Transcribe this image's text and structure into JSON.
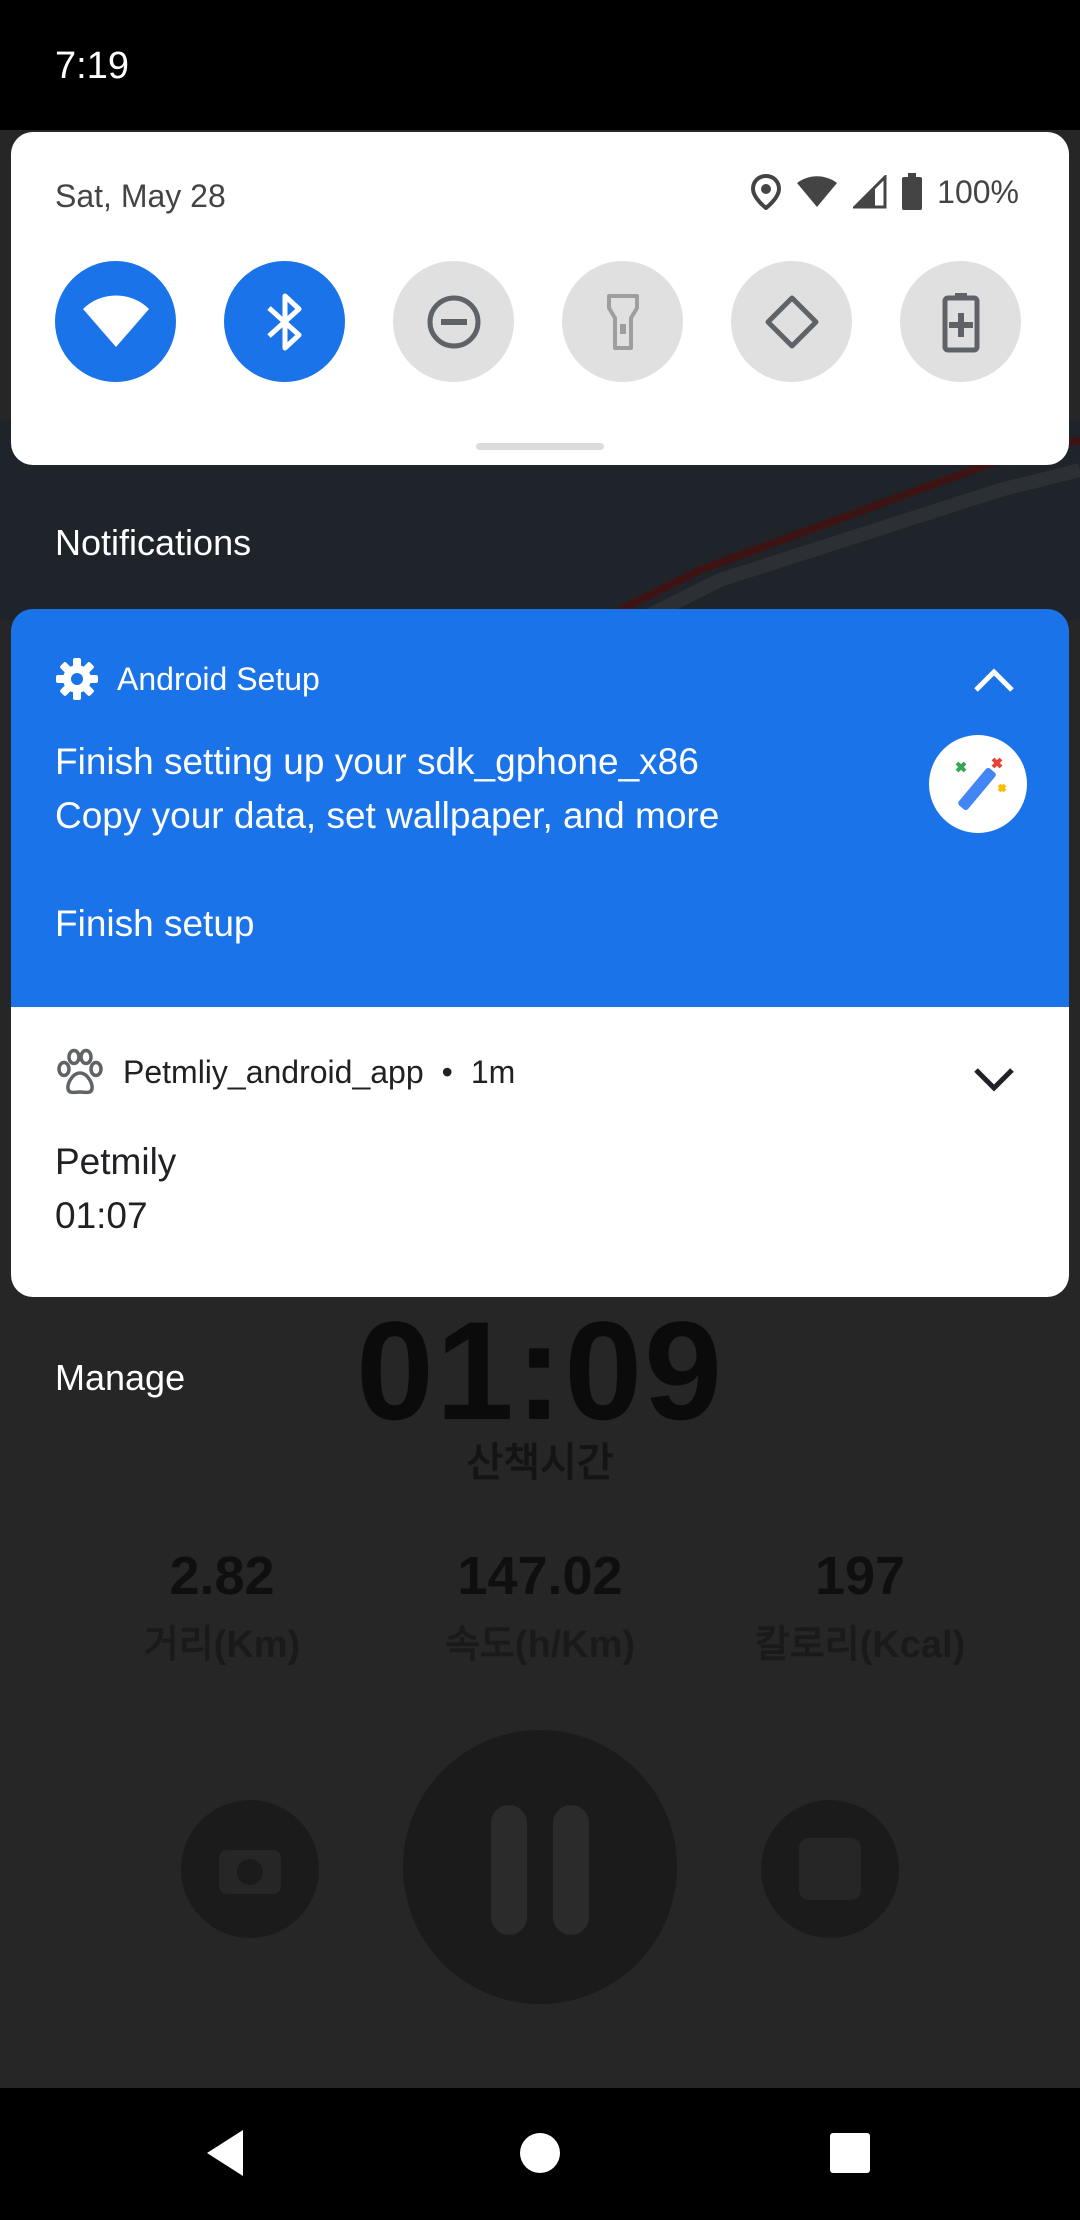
{
  "status_bar": {
    "time": "7:19"
  },
  "quick_settings": {
    "date": "Sat, May 28",
    "battery_text": "100%",
    "tiles": [
      {
        "name": "wifi",
        "state": "on"
      },
      {
        "name": "bluetooth",
        "state": "on"
      },
      {
        "name": "do-not-disturb",
        "state": "off"
      },
      {
        "name": "flashlight",
        "state": "off"
      },
      {
        "name": "auto-rotate",
        "state": "off"
      },
      {
        "name": "battery-saver",
        "state": "off"
      }
    ]
  },
  "notifications_label": "Notifications",
  "notifications": [
    {
      "app": "Android Setup",
      "title": "Finish setting up your sdk_gphone_x86",
      "text": "Copy your data, set wallpaper, and more",
      "action": "Finish setup",
      "color": "#1a73e8"
    },
    {
      "app": "Petmliy_android_app",
      "time": "1m",
      "title": "Petmily",
      "text": "01:07"
    }
  ],
  "manage_label": "Manage",
  "background_app": {
    "timer": "01:09",
    "timer_label": "산책시간",
    "stats": [
      {
        "value": "2.82",
        "label": "거리(Km)"
      },
      {
        "value": "147.02",
        "label": "속도(h/Km)"
      },
      {
        "value": "197",
        "label": "칼로리(Kcal)"
      }
    ]
  },
  "colors": {
    "accent": "#1a73e8",
    "tile_off": "#e0e0e0"
  }
}
